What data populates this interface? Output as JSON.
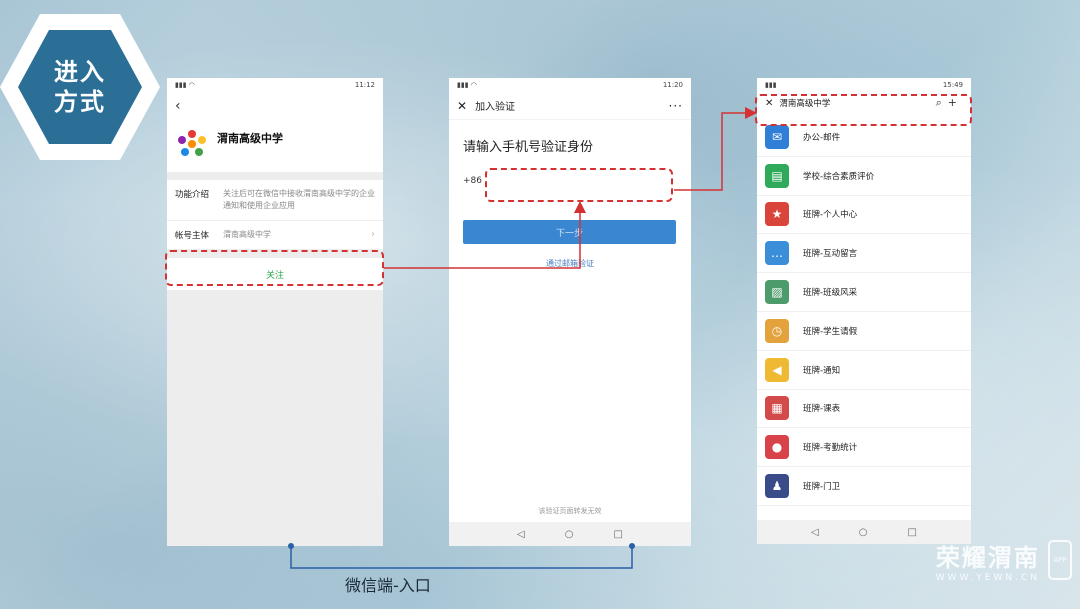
{
  "badge": {
    "text": "进入方式"
  },
  "phone1": {
    "status_time": "11:12",
    "back": "‹",
    "org_name": "渭南高级中学",
    "rows": [
      {
        "key": "功能介绍",
        "value": "关注后可在微信中接收渭南高级中学的企业通知和使用企业应用"
      },
      {
        "key": "帐号主体",
        "value": "渭南高级中学"
      }
    ],
    "follow_label": "关注"
  },
  "phone2": {
    "status_time": "11:20",
    "nav_title": "加入验证",
    "heading": "请输入手机号验证身份",
    "country_code": "+86",
    "phone_value": "",
    "next_label": "下一步",
    "email_link": "通过邮箱验证",
    "footer": "该验证页面转发无效"
  },
  "phone3": {
    "status_time": "15:49",
    "nav_title": "渭南高级中学",
    "apps": [
      {
        "label": "办公-邮件",
        "icon": "mail-icon",
        "color": "#2f7fd6"
      },
      {
        "label": "学校-综合素质评价",
        "icon": "document-icon",
        "color": "#2eaa5a"
      },
      {
        "label": "班牌-个人中心",
        "icon": "medal-icon",
        "color": "#d9453b"
      },
      {
        "label": "班牌-互动留言",
        "icon": "chat-icon",
        "color": "#3b8fd9"
      },
      {
        "label": "班牌-班级风采",
        "icon": "picture-icon",
        "color": "#4c9b6a"
      },
      {
        "label": "班牌-学生请假",
        "icon": "clock-icon",
        "color": "#e3a23b"
      },
      {
        "label": "班牌-通知",
        "icon": "megaphone-icon",
        "color": "#f0b933"
      },
      {
        "label": "班牌-课表",
        "icon": "calendar-icon",
        "color": "#d34a4a"
      },
      {
        "label": "班牌-考勤统计",
        "icon": "location-icon",
        "color": "#d8434a"
      },
      {
        "label": "班牌-门卫",
        "icon": "guard-icon",
        "color": "#3a4b8a"
      }
    ]
  },
  "caption": "微信端-入口",
  "watermark": {
    "main": "荣耀渭南",
    "sub": "WWW.YEWN.CN",
    "app": "APP"
  },
  "colors": {
    "accent": "#3a86d1",
    "annotation": "#d43232",
    "follow": "#2fa84f"
  }
}
